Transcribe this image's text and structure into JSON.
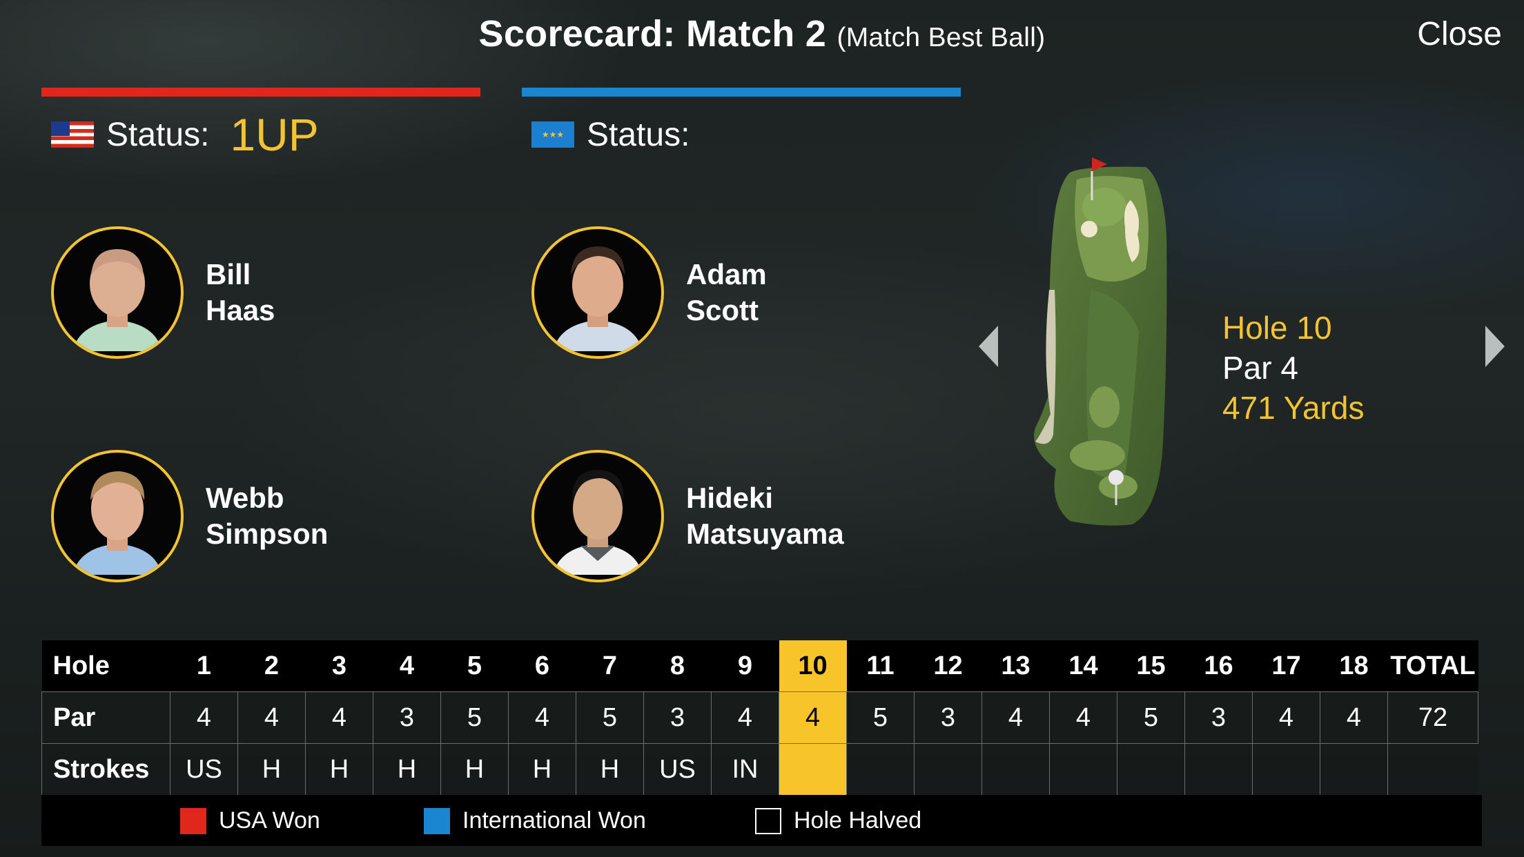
{
  "header": {
    "title": "Scorecard: Match 2",
    "subtitle": "(Match Best Ball)",
    "close_label": "Close"
  },
  "teams": {
    "usa": {
      "status_label": "Status:",
      "status_value": "1UP",
      "color": "#e1261c",
      "flag_icon": "us-flag-icon"
    },
    "international": {
      "status_label": "Status:",
      "status_value": "",
      "color": "#1a86d2",
      "flag_icon": "international-flag-icon"
    }
  },
  "players": {
    "usa": [
      {
        "first": "Bill",
        "last": "Haas"
      },
      {
        "first": "Webb",
        "last": "Simpson"
      }
    ],
    "international": [
      {
        "first": "Adam",
        "last": "Scott"
      },
      {
        "first": "Hideki",
        "last": "Matsuyama"
      }
    ]
  },
  "hole": {
    "number_label": "Hole 10",
    "par_label": "Par 4",
    "yards_label": "471 Yards"
  },
  "scorecard": {
    "hole_label": "Hole",
    "par_label": "Par",
    "strokes_label": "Strokes",
    "total_label": "TOTAL",
    "holes": [
      "1",
      "2",
      "3",
      "4",
      "5",
      "6",
      "7",
      "8",
      "9",
      "10",
      "11",
      "12",
      "13",
      "14",
      "15",
      "16",
      "17",
      "18"
    ],
    "par": [
      "4",
      "4",
      "4",
      "3",
      "5",
      "4",
      "5",
      "3",
      "4",
      "4",
      "5",
      "3",
      "4",
      "4",
      "5",
      "3",
      "4",
      "4"
    ],
    "par_total": "72",
    "strokes": [
      "US",
      "H",
      "H",
      "H",
      "H",
      "H",
      "H",
      "US",
      "IN",
      "",
      "",
      "",
      "",
      "",
      "",
      "",
      "",
      ""
    ],
    "current_hole": "10"
  },
  "legend": {
    "usa_won": "USA Won",
    "international_won": "International Won",
    "hole_halved": "Hole Halved"
  },
  "colors": {
    "accent_gold": "#f4c430",
    "current_hole_bg": "#f7c42a",
    "usa_red": "#e1261c",
    "international_blue": "#1a86d2"
  }
}
